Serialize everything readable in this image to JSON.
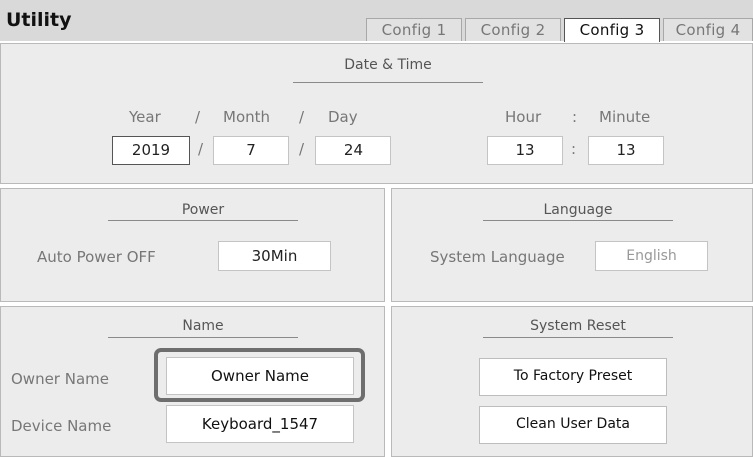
{
  "header": {
    "title": "Utility",
    "tabs": [
      {
        "label": "Config 1",
        "active": false
      },
      {
        "label": "Config 2",
        "active": false
      },
      {
        "label": "Config 3",
        "active": true
      },
      {
        "label": "Config 4",
        "active": false
      }
    ]
  },
  "date_time": {
    "title": "Date & Time",
    "year_label": "Year",
    "month_label": "Month",
    "day_label": "Day",
    "hour_label": "Hour",
    "minute_label": "Minute",
    "date_sep": "/",
    "time_sep": ":",
    "year": "2019",
    "month": "7",
    "day": "24",
    "hour": "13",
    "minute": "13"
  },
  "power": {
    "title": "Power",
    "auto_off_label": "Auto Power OFF",
    "auto_off_value": "30Min"
  },
  "language": {
    "title": "Language",
    "system_language_label": "System Language",
    "system_language_value": "English"
  },
  "name": {
    "title": "Name",
    "owner_label": "Owner Name",
    "owner_value": "Owner Name",
    "device_label": "Device Name",
    "device_value": "Keyboard_1547"
  },
  "system_reset": {
    "title": "System Reset",
    "factory_preset_label": "To Factory Preset",
    "clean_user_data_label": "Clean User Data"
  },
  "colors": {
    "topbar": "#d9d9d9",
    "panel": "#ececec",
    "focus_ring": "#6e6e6e"
  }
}
